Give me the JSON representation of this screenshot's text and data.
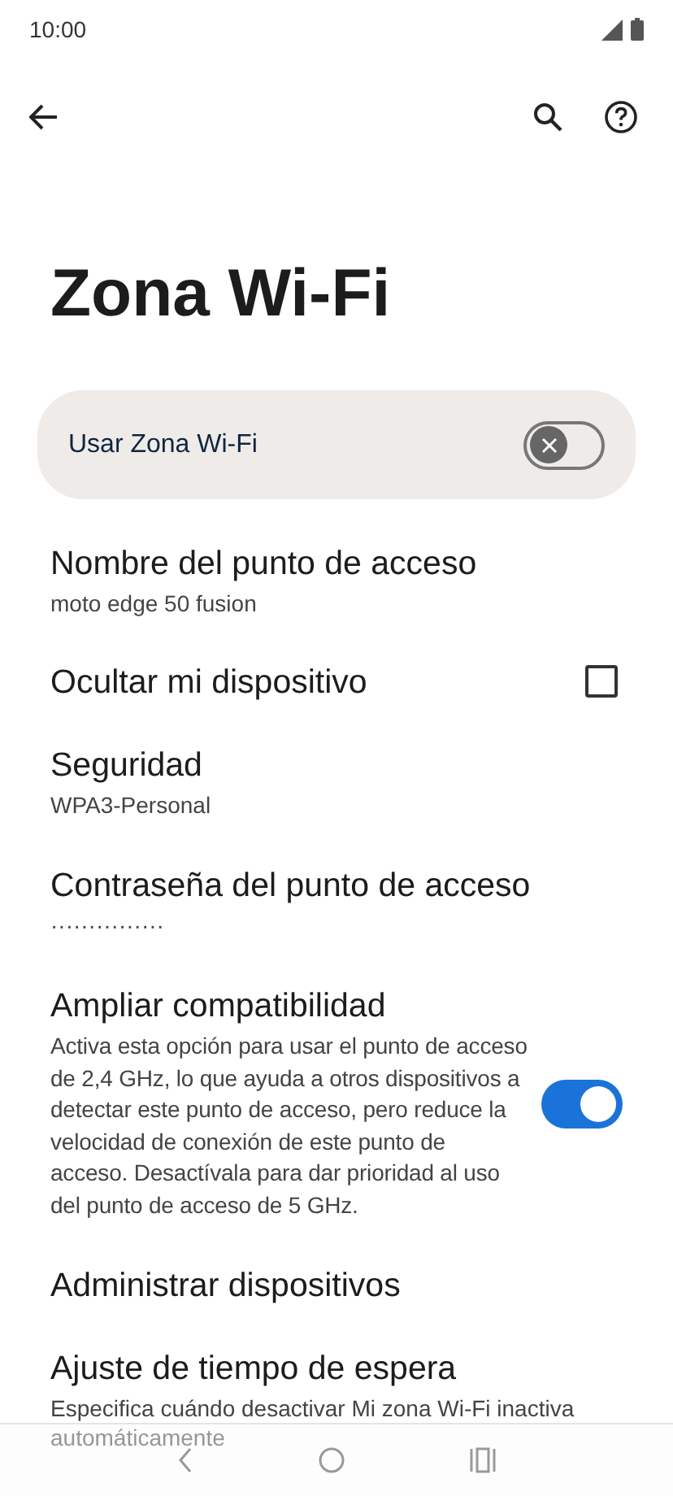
{
  "status_bar": {
    "time": "10:00"
  },
  "title": "Zona Wi-Fi",
  "main_switch": {
    "label": "Usar Zona Wi-Fi",
    "on": false
  },
  "items": [
    {
      "kind": "text",
      "title": "Nombre del punto de acceso",
      "summary": "moto edge 50 fusion"
    },
    {
      "kind": "checkbox",
      "title": "Ocultar mi dispositivo",
      "checked": false
    },
    {
      "kind": "text",
      "title": "Seguridad",
      "summary": "WPA3-Personal"
    },
    {
      "kind": "text",
      "title": "Contraseña del punto de acceso",
      "summary": "···············"
    },
    {
      "kind": "switch",
      "title": "Ampliar compatibilidad",
      "summary": "Activa esta opción para usar el punto de acceso de 2,4 GHz, lo que ayuda a otros dispositivos a detectar este punto de acceso, pero reduce la velocidad de conexión de este punto de acceso. Desactívala para dar prioridad al uso del punto de acceso de 5 GHz.",
      "on": true
    },
    {
      "kind": "text",
      "title": "Administrar dispositivos"
    },
    {
      "kind": "text",
      "title": "Ajuste de tiempo de espera",
      "summary": "Especifica cuándo desactivar Mi zona Wi-Fi inactiva automáticamente"
    }
  ]
}
